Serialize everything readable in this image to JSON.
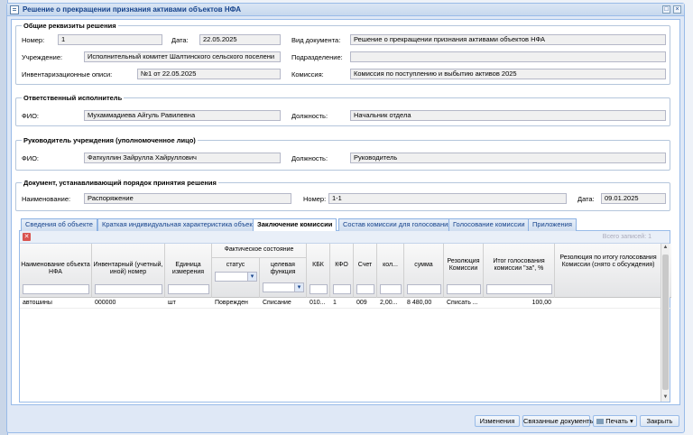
{
  "window": {
    "title": "Решение о прекращении признания активами объектов НФА"
  },
  "general": {
    "legend": "Общие реквизиты решения",
    "number_label": "Номер:",
    "number_value": "1",
    "date_label": "Дата:",
    "date_value": "22.05.2025",
    "doc_type_label": "Вид документа:",
    "doc_type_value": "Решение о прекращении признания активами объектов НФА",
    "institution_label": "Учреждение:",
    "institution_value": "Исполнительный комитет Шалтинского сельского поселени",
    "department_label": "Подразделение:",
    "department_value": "",
    "inventory_label": "Инвентаризационные описи:",
    "inventory_value": "№1 от 22.05.2025",
    "commission_label": "Комиссия:",
    "commission_value": "Комиссия по поступлению и выбытию активов 2025"
  },
  "responsible": {
    "legend": "Ответственный исполнитель",
    "fio_label": "ФИО:",
    "fio_value": "Мухаммадиева Айгуль Равилевна",
    "position_label": "Должность:",
    "position_value": "Начальник отдела"
  },
  "head": {
    "legend": "Руководитель учреждения (уполномоченное лицо)",
    "fio_label": "ФИО:",
    "fio_value": "Фаткуллин Зайрулла Хайруллович",
    "position_label": "Должность:",
    "position_value": "Руководитель"
  },
  "procedure_doc": {
    "legend": "Документ, устанавливающий порядок принятия решения",
    "name_label": "Наименование:",
    "name_value": "Распоряжение",
    "number_label": "Номер:",
    "number_value": "1-1",
    "date_label": "Дата:",
    "date_value": "09.01.2025"
  },
  "tabs": [
    "Сведения об объекте",
    "Краткая индивидуальная характеристика объекта",
    "Заключение комиссии",
    "Состав комиссии для голосования",
    "Голосование комиссии",
    "Приложения"
  ],
  "grid": {
    "total_label": "Всего записей: 1",
    "group_header": "Фактическое состояние",
    "headers": {
      "name": "Наименование объекта НФА",
      "inv": "Инвентарный (учетный, иной) номер",
      "unit": "Единица измерения",
      "status": "статус",
      "purpose": "целевая функция",
      "kbk": "КБК",
      "kfo": "КФО",
      "account": "Счет",
      "qty": "кол...",
      "sum": "сумма",
      "resolution": "Резолюция Комиссии",
      "vote": "Итог голосования комиссии \"за\", %",
      "resolution_final": "Резолюция по итогу голосования Комиссии (снято с обсуждения)"
    },
    "row": {
      "name": "автошины",
      "inv": "000000",
      "unit": "шт",
      "status": "Поврежден",
      "purpose": "Списание",
      "kbk": "010...",
      "kfo": "1",
      "account": "009",
      "qty": "2,00...",
      "sum": "8 480,00",
      "resolution": "Списать ...",
      "vote": "100,00",
      "resolution_final": ""
    }
  },
  "footer": {
    "changes": "Изменения",
    "linked_docs": "Связанные документы",
    "print": "Печать",
    "close": "Закрыть"
  }
}
